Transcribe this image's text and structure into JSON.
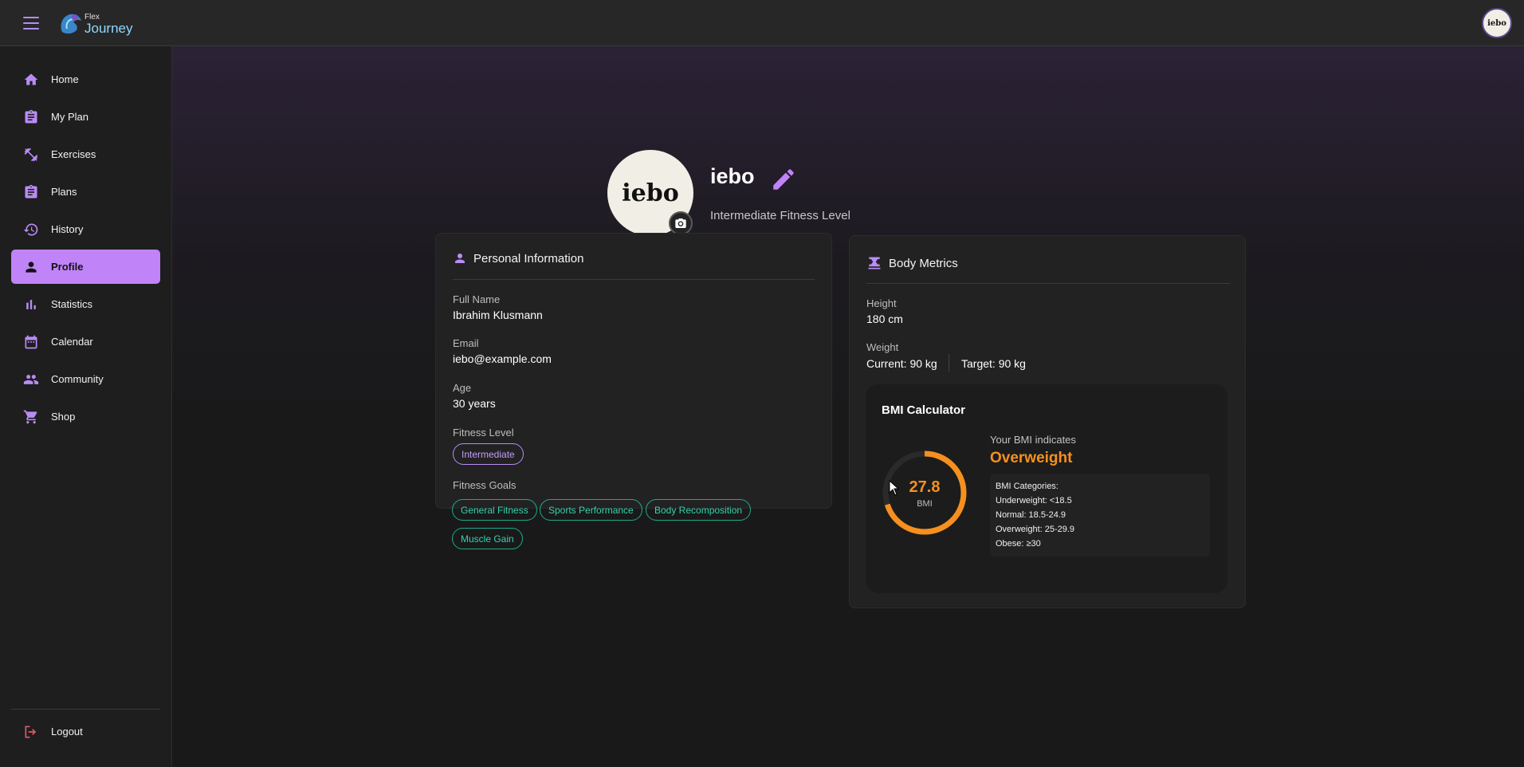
{
  "app": {
    "logo_small": "Flex",
    "logo_big": "Journey",
    "avatar_text": "iebo"
  },
  "sidebar": {
    "items": [
      {
        "label": "Home",
        "icon": "home-icon"
      },
      {
        "label": "My Plan",
        "icon": "clipboard-icon"
      },
      {
        "label": "Exercises",
        "icon": "dumbbell-icon"
      },
      {
        "label": "Plans",
        "icon": "clipboard-list-icon"
      },
      {
        "label": "History",
        "icon": "history-icon"
      },
      {
        "label": "Profile",
        "icon": "person-icon",
        "active": true
      },
      {
        "label": "Statistics",
        "icon": "bar-chart-icon"
      },
      {
        "label": "Calendar",
        "icon": "calendar-icon"
      },
      {
        "label": "Community",
        "icon": "group-icon"
      },
      {
        "label": "Shop",
        "icon": "cart-icon"
      }
    ],
    "logout": "Logout"
  },
  "profile": {
    "avatar_text": "iebo",
    "username": "iebo",
    "level_subtitle": "Intermediate Fitness Level"
  },
  "personal_info": {
    "title": "Personal Information",
    "full_name_label": "Full Name",
    "full_name": "Ibrahim Klusmann",
    "email_label": "Email",
    "email": "iebo@example.com",
    "age_label": "Age",
    "age": "30 years",
    "fitness_level_label": "Fitness Level",
    "fitness_level": "Intermediate",
    "goals_label": "Fitness Goals",
    "goals": [
      "General Fitness",
      "Sports Performance",
      "Body Recomposition",
      "Muscle Gain"
    ]
  },
  "body_metrics": {
    "title": "Body Metrics",
    "height_label": "Height",
    "height": "180 cm",
    "weight_label": "Weight",
    "weight_current": "Current: 90 kg",
    "weight_target": "Target: 90 kg",
    "bmi": {
      "title": "BMI Calculator",
      "value": "27.8",
      "unit": "BMI",
      "gauge_fraction": 0.7,
      "indicates": "Your BMI indicates",
      "status": "Overweight",
      "categories": [
        "BMI Categories:",
        "Underweight: <18.5",
        "Normal: 18.5-24.9",
        "Overweight: 25-29.9",
        "Obese: ≥30"
      ]
    }
  },
  "colors": {
    "accent": "#c083f8",
    "bmi_orange": "#f5901e",
    "teal": "#1fa98b"
  }
}
